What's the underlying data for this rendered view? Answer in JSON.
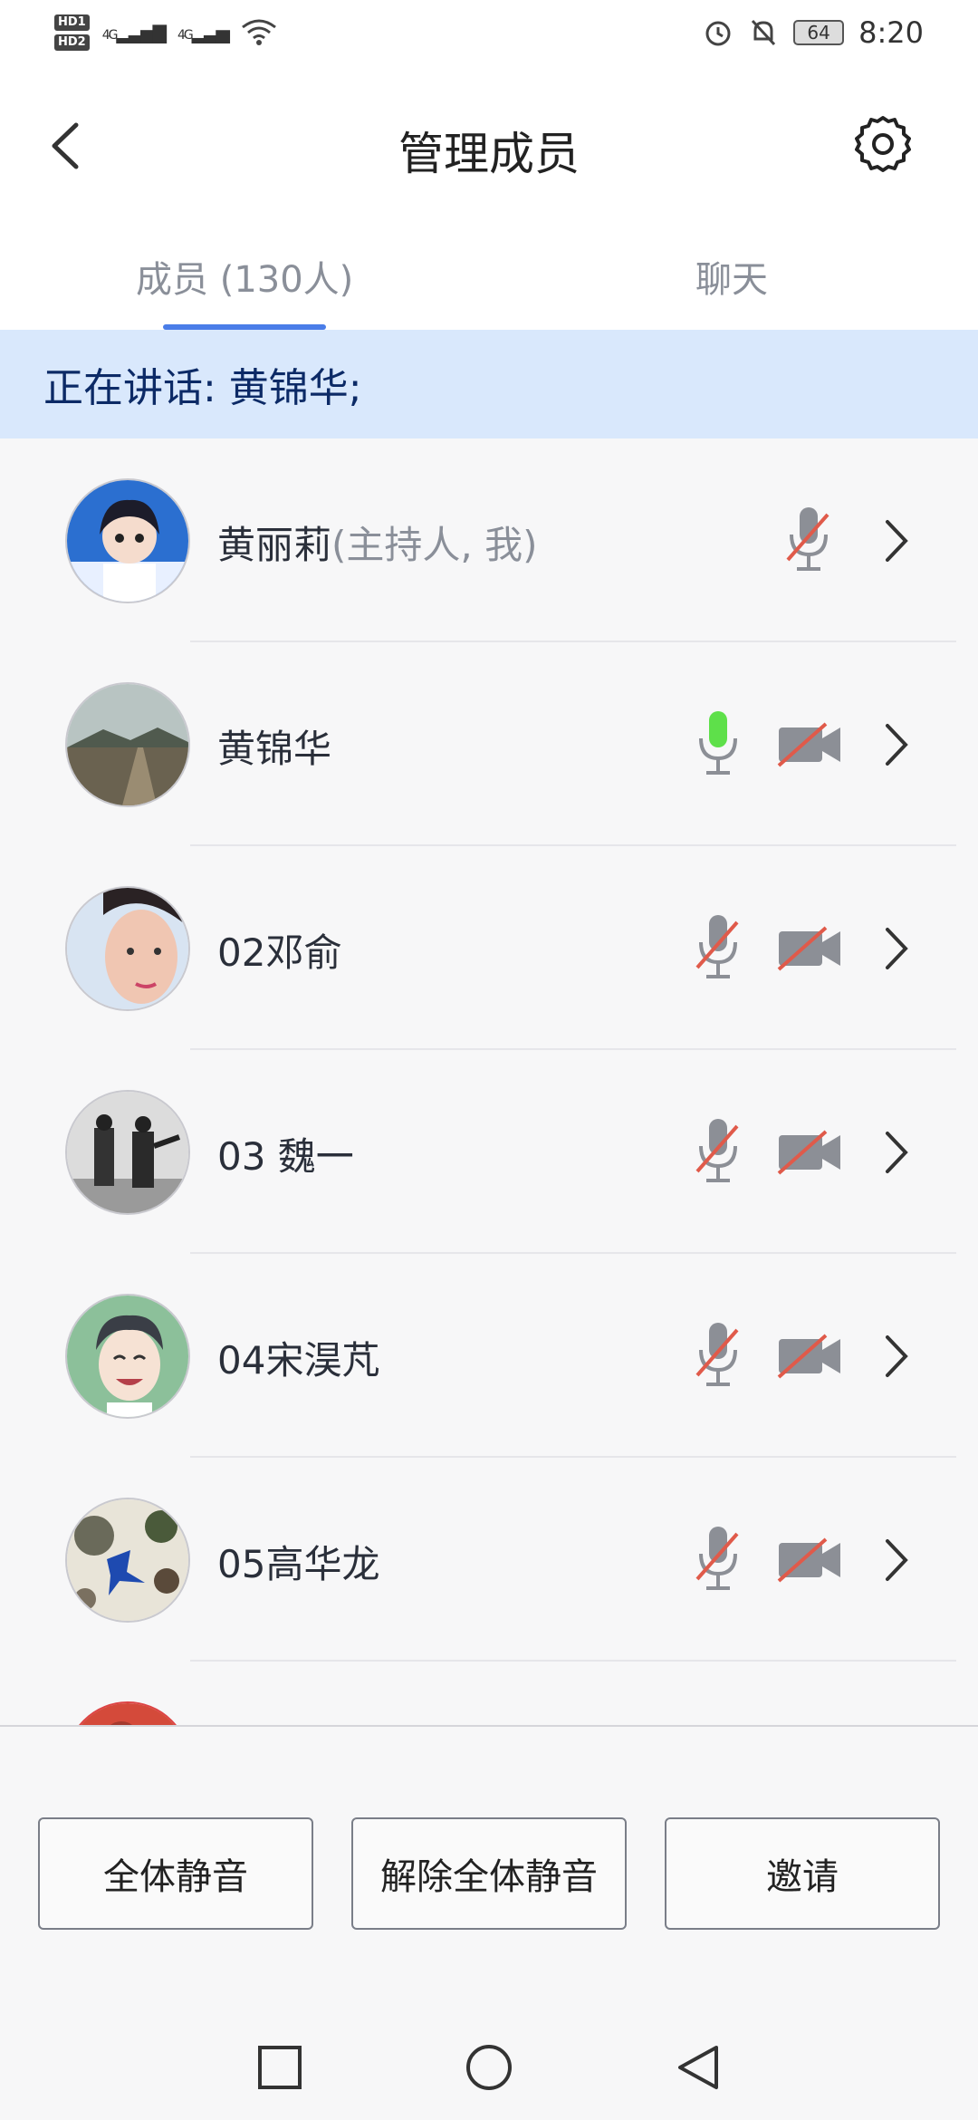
{
  "status_bar": {
    "hd1": "HD1",
    "hd2": "HD2",
    "signal1": "4G",
    "signal2": "4G",
    "battery": "64",
    "time": "8:20"
  },
  "header": {
    "title": "管理成员"
  },
  "tabs": [
    {
      "label": "成员 (130人)",
      "active": true
    },
    {
      "label": "聊天",
      "active": false
    }
  ],
  "speaking": {
    "text": "正在讲话: 黄锦华;"
  },
  "members": [
    {
      "name": "黄丽莉",
      "role": "(主持人, 我)",
      "mic": "muted",
      "camera": "none",
      "avatar": "anime-girl"
    },
    {
      "name": "黄锦华",
      "role": "",
      "mic": "active",
      "camera": "off",
      "avatar": "road-landscape"
    },
    {
      "name": "02邓俞",
      "role": "",
      "mic": "muted",
      "camera": "off",
      "avatar": "woman-portrait"
    },
    {
      "name": "03 魏一",
      "role": "",
      "mic": "muted",
      "camera": "off",
      "avatar": "bw-dancers"
    },
    {
      "name": "04宋淏芃",
      "role": "",
      "mic": "muted",
      "camera": "off",
      "avatar": "cartoon-boy"
    },
    {
      "name": "05高华龙",
      "role": "",
      "mic": "muted",
      "camera": "off",
      "avatar": "abstract-photo"
    }
  ],
  "buttons": {
    "mute_all": "全体静音",
    "unmute_all": "解除全体静音",
    "invite": "邀请"
  },
  "colors": {
    "accent": "#4a7de8",
    "banner_bg": "#d9e8fc",
    "banner_text": "#0c2a66",
    "mic_active": "#5ee04a",
    "muted_slash": "#e05a4a"
  }
}
